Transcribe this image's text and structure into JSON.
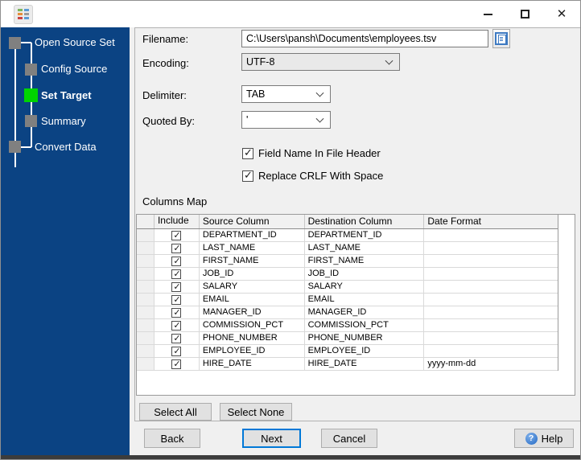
{
  "colors": {
    "sidebar_bg": "#0B4383",
    "active_step_green": "#00D400",
    "inactive_step_gray": "#808080",
    "accent_blue": "#0078D7"
  },
  "window": {
    "icons": {
      "close": "✕",
      "help": "?"
    }
  },
  "sidebar": {
    "steps": [
      {
        "label": "Open Source Set",
        "state": "inactive"
      },
      {
        "label": "Config Source",
        "state": "inactive"
      },
      {
        "label": "Set Target",
        "state": "active"
      },
      {
        "label": "Summary",
        "state": "inactive"
      },
      {
        "label": "Convert Data",
        "state": "inactive"
      }
    ]
  },
  "form": {
    "filename_label": "Filename:",
    "filename_value": "C:\\Users\\pansh\\Documents\\employees.tsv",
    "encoding_label": "Encoding:",
    "encoding_value": "UTF-8",
    "delimiter_label": "Delimiter:",
    "delimiter_value": "TAB",
    "quoted_label": "Quoted By:",
    "quoted_value": "'",
    "checkbox_header": {
      "label": "Field Name In File Header",
      "checked": true
    },
    "checkbox_crlf": {
      "label": "Replace CRLF With Space",
      "checked": true
    }
  },
  "columns_map": {
    "title": "Columns Map",
    "headers": {
      "include": "Include",
      "source": "Source Column",
      "destination": "Destination Column",
      "date_format": "Date Format"
    },
    "rows": [
      {
        "include": true,
        "source": "DEPARTMENT_ID",
        "destination": "DEPARTMENT_ID",
        "date_format": ""
      },
      {
        "include": true,
        "source": "LAST_NAME",
        "destination": "LAST_NAME",
        "date_format": ""
      },
      {
        "include": true,
        "source": "FIRST_NAME",
        "destination": "FIRST_NAME",
        "date_format": ""
      },
      {
        "include": true,
        "source": "JOB_ID",
        "destination": "JOB_ID",
        "date_format": ""
      },
      {
        "include": true,
        "source": "SALARY",
        "destination": "SALARY",
        "date_format": ""
      },
      {
        "include": true,
        "source": "EMAIL",
        "destination": "EMAIL",
        "date_format": ""
      },
      {
        "include": true,
        "source": "MANAGER_ID",
        "destination": "MANAGER_ID",
        "date_format": ""
      },
      {
        "include": true,
        "source": "COMMISSION_PCT",
        "destination": "COMMISSION_PCT",
        "date_format": ""
      },
      {
        "include": true,
        "source": "PHONE_NUMBER",
        "destination": "PHONE_NUMBER",
        "date_format": ""
      },
      {
        "include": true,
        "source": "EMPLOYEE_ID",
        "destination": "EMPLOYEE_ID",
        "date_format": ""
      },
      {
        "include": true,
        "source": "HIRE_DATE",
        "destination": "HIRE_DATE",
        "date_format": "yyyy-mm-dd"
      }
    ]
  },
  "buttons": {
    "select_all": "Select All",
    "select_none": "Select None",
    "back": "Back",
    "next": "Next",
    "cancel": "Cancel",
    "help": "Help"
  }
}
